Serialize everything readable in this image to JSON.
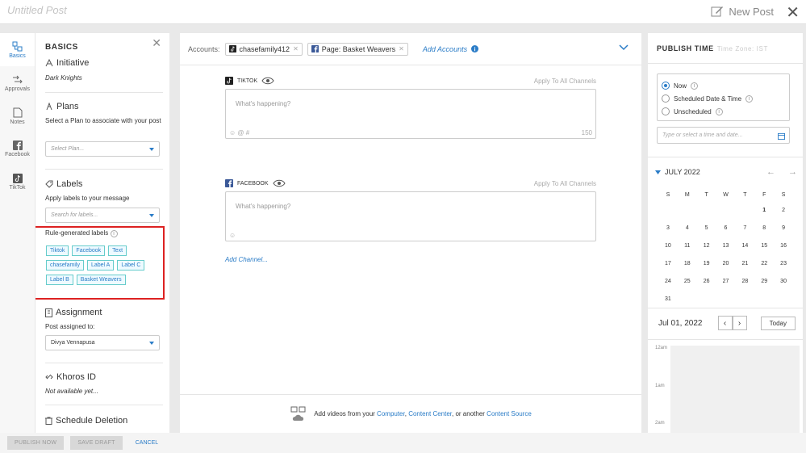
{
  "header": {
    "post_title": "Untitled Post",
    "new_post_label": "New Post"
  },
  "nav": {
    "items": [
      {
        "label": "Basics",
        "icon": "basics-icon"
      },
      {
        "label": "Approvals",
        "icon": "approvals-icon"
      },
      {
        "label": "Notes",
        "icon": "notes-icon"
      },
      {
        "label": "Facebook",
        "icon": "facebook-icon"
      },
      {
        "label": "TikTok",
        "icon": "tiktok-icon"
      }
    ]
  },
  "basics": {
    "title": "BASICS",
    "initiative": {
      "title": "Initiative",
      "value": "Dark Knights"
    },
    "plans": {
      "title": "Plans",
      "text": "Select a Plan to associate with your post",
      "placeholder": "Select Plan..."
    },
    "labels": {
      "title": "Labels",
      "text": "Apply labels to your message",
      "placeholder": "Search for labels..."
    },
    "rule_generated": {
      "title": "Rule-generated labels",
      "tags": [
        "Tiktok",
        "Facebook",
        "Text",
        "chasefamily",
        "Label A",
        "Label C",
        "Label B",
        "Basket Weavers"
      ]
    },
    "assignment": {
      "title": "Assignment",
      "text": "Post assigned to:",
      "value": "Divya Vennapusa"
    },
    "khoros_id": {
      "title": "Khoros ID",
      "value": "Not available yet..."
    },
    "schedule_deletion": {
      "title": "Schedule Deletion"
    }
  },
  "main": {
    "accounts_label": "Accounts:",
    "accounts": [
      {
        "name": "chasefamily412",
        "icon": "tiktok-icon"
      },
      {
        "name": "Page: Basket Weavers",
        "icon": "facebook-icon"
      }
    ],
    "add_accounts": "Add Accounts",
    "channels": [
      {
        "name": "TIKTOK",
        "apply": "Apply To All Channels",
        "placeholder": "What's happening?",
        "tools": "☺ @ #",
        "count": "150"
      },
      {
        "name": "FACEBOOK",
        "apply": "Apply To All Channels",
        "placeholder": "What's happening?",
        "tools": "☺",
        "count": ""
      }
    ],
    "add_channel": "Add Channel...",
    "footer": {
      "prefix": "Add videos from your",
      "computer": "Computer",
      "sep": ",",
      "content_center": "Content Center",
      "middle": ", or another",
      "content_source": "Content Source"
    }
  },
  "publish": {
    "title": "PUBLISH TIME",
    "timezone": "Time Zone: IST",
    "options": [
      "Now",
      "Scheduled Date & Time",
      "Unscheduled"
    ],
    "selected": "Now",
    "dt_placeholder": "Type or select a time and date...",
    "month": "JULY 2022",
    "dow": [
      "S",
      "M",
      "T",
      "W",
      "T",
      "F",
      "S"
    ],
    "days": [
      "",
      "",
      "",
      "",
      "",
      "1",
      "2",
      "3",
      "4",
      "5",
      "6",
      "7",
      "8",
      "9",
      "10",
      "11",
      "12",
      "13",
      "14",
      "15",
      "16",
      "17",
      "18",
      "19",
      "20",
      "21",
      "22",
      "23",
      "24",
      "25",
      "26",
      "27",
      "28",
      "29",
      "30",
      "31"
    ],
    "current_date": "Jul 01, 2022",
    "today_label": "Today",
    "times": [
      "12am",
      "1am",
      "2am"
    ]
  },
  "footer": {
    "publish_now": "PUBLISH NOW",
    "save_draft": "SAVE DRAFT",
    "cancel": "CANCEL"
  },
  "colors": {
    "accent": "#2a7cc7",
    "highlight_box": "#dd2222"
  }
}
